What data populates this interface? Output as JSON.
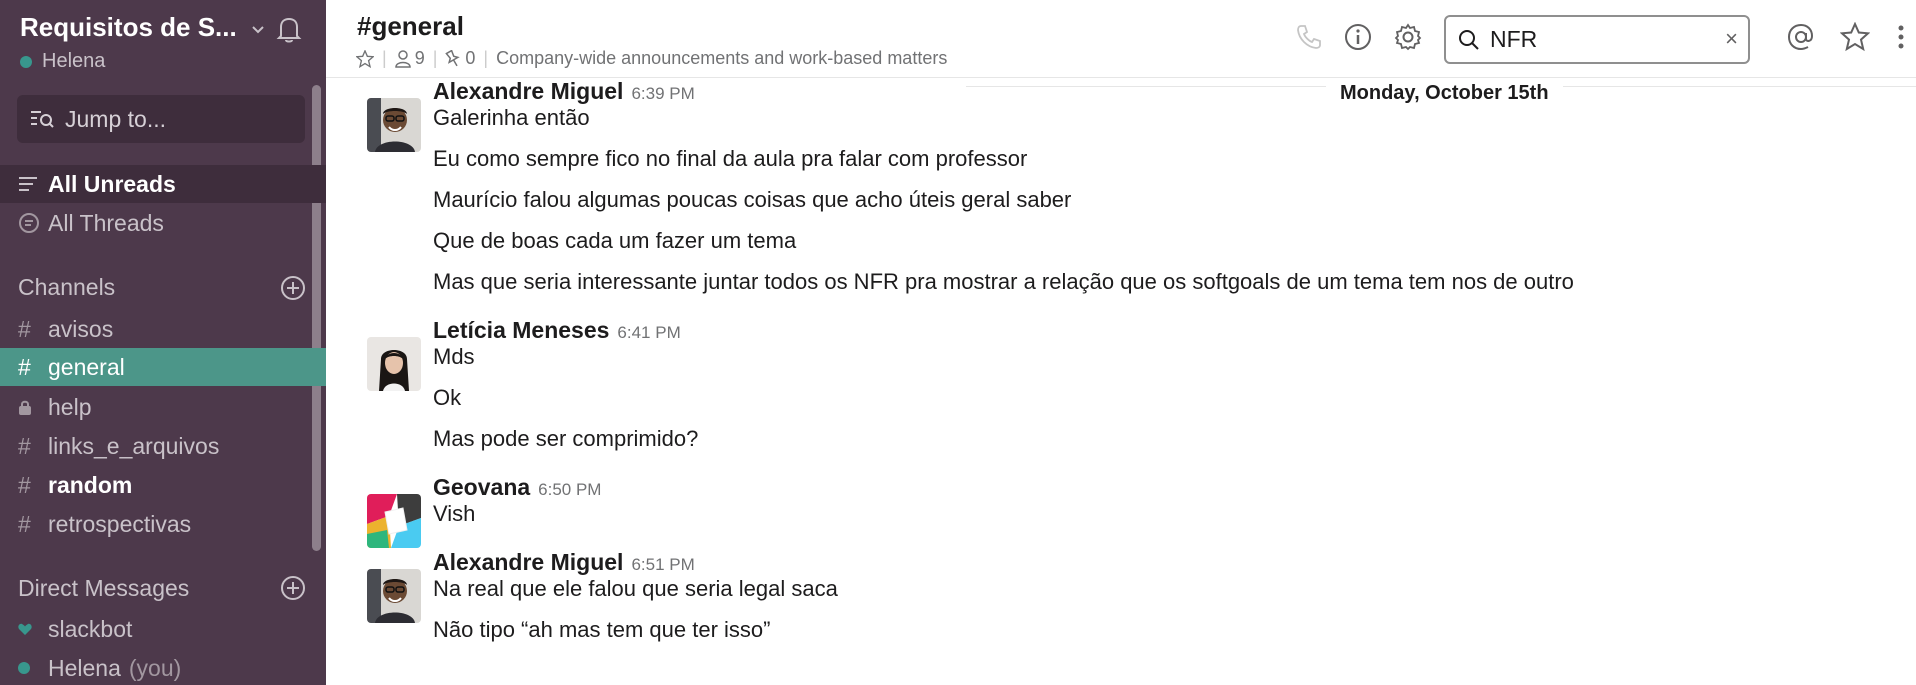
{
  "workspace": {
    "name": "Requisitos de S...",
    "user": "Helena"
  },
  "sidebar": {
    "jump_placeholder": "Jump to...",
    "top_items": [
      {
        "label": "All Unreads",
        "icon": "list-icon"
      },
      {
        "label": "All Threads",
        "icon": "threads-icon"
      }
    ],
    "channels_header": "Channels",
    "channels": [
      {
        "prefix": "#",
        "label": "avisos",
        "state": "normal"
      },
      {
        "prefix": "#",
        "label": "general",
        "state": "active"
      },
      {
        "prefix": "lock",
        "label": "help",
        "state": "normal"
      },
      {
        "prefix": "#",
        "label": "links_e_arquivos",
        "state": "normal"
      },
      {
        "prefix": "#",
        "label": "random",
        "state": "unread"
      },
      {
        "prefix": "#",
        "label": "retrospectivas",
        "state": "normal"
      }
    ],
    "dm_header": "Direct Messages",
    "dms": [
      {
        "label": "slackbot",
        "icon": "heart-icon"
      },
      {
        "label": "Helena",
        "suffix": "(you)",
        "icon": "online-dot"
      }
    ]
  },
  "header": {
    "channel": "#general",
    "members": "9",
    "pins": "0",
    "topic": "Company-wide announcements and work-based matters",
    "search_value": "NFR",
    "search_clear": "×"
  },
  "messages": {
    "date": "Monday, October 15th",
    "groups": [
      {
        "author": "Alexandre Miguel",
        "time": "6:39 PM",
        "avatar": "photo-man",
        "lines": [
          "Galerinha então",
          "Eu como sempre fico no final da aula pra falar com professor",
          "Maurício falou algumas poucas coisas que acho úteis geral saber",
          "Que de boas cada um fazer um tema",
          "Mas que seria interessante juntar todos os NFR pra mostrar a relação que os softgoals de um tema tem nos de outro"
        ]
      },
      {
        "author": "Letícia Meneses",
        "time": "6:41 PM",
        "avatar": "photo-woman",
        "lines": [
          "Mds",
          "Ok",
          "Mas pode ser comprimido?"
        ]
      },
      {
        "author": "Geovana",
        "time": "6:50 PM",
        "avatar": "default-slack",
        "lines": [
          "Vish"
        ]
      },
      {
        "author": "Alexandre Miguel",
        "time": "6:51 PM",
        "avatar": "photo-man",
        "lines": [
          "Na real que ele falou que seria legal saca",
          "Não tipo “ah mas tem que ter isso”"
        ]
      }
    ]
  },
  "colors": {
    "sidebar": "#4d394b",
    "active_channel": "#4c9689",
    "presence": "#38978d"
  }
}
